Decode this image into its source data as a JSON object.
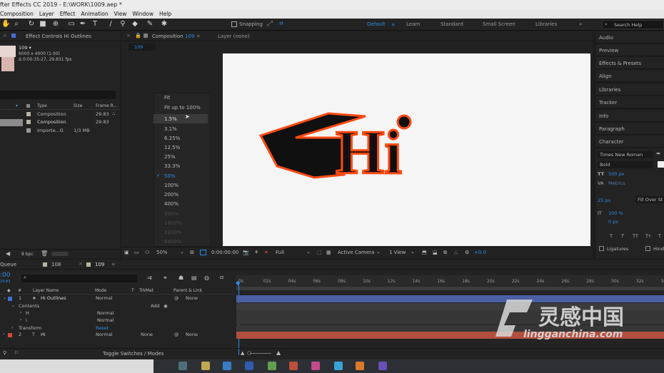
{
  "title": "fter Effects CC 2019 - E:\\WORK\\1009.aep *",
  "menu": [
    "Composition",
    "Layer",
    "Effect",
    "Animation",
    "View",
    "Window",
    "Help"
  ],
  "toolbar": {
    "snapping": "Snapping",
    "workspaces": [
      "Default",
      "Learn",
      "Standard",
      "Small Screen",
      "Libraries"
    ],
    "search": "Search Help"
  },
  "project": {
    "effect_tab": "Effect Controls Hi Outlines",
    "item_name": "109 ▾",
    "item_size": "6000 x 4000 (1.00)",
    "item_dur": "Δ 0:00:35:27, 29.831 fps",
    "columns": [
      "Type",
      "Size",
      "Frame R..."
    ],
    "rows": [
      {
        "type": "Composition",
        "size": "",
        "fps": "29.83"
      },
      {
        "type": "Composition",
        "size": "",
        "fps": "29.83"
      },
      {
        "type": "Importe...G",
        "size": "1/3 MB",
        "fps": ""
      }
    ],
    "bpc": "8 bpc"
  },
  "comp": {
    "tab": "Composition",
    "tab_num": "109",
    "layer_tab": "Layer (none)",
    "crumb": "109",
    "zoom_options": [
      "Fit",
      "Fit up to 100%",
      "1.5%",
      "3.1%",
      "6.25%",
      "12.5%",
      "25%",
      "33.3%",
      "50%",
      "100%",
      "200%",
      "400%",
      "800%",
      "1600%",
      "3200%",
      "6400%"
    ],
    "selected_zoom": "50%",
    "hover_zoom": "1.5%",
    "footer": {
      "zoom": "50%",
      "time": "0:00:00:00",
      "res": "Full",
      "camera": "Active Camera",
      "views": "1 View",
      "offset": "+0.0"
    },
    "art_text": "Hi"
  },
  "right_panels": [
    "Audio",
    "Preview",
    "Effects & Presets",
    "Align",
    "Libraries",
    "Tracker",
    "Info",
    "Paragraph",
    "Character"
  ],
  "character": {
    "font": "Times New Roman",
    "style": "Bold",
    "size": "500 px",
    "tracking_label": "Metrics",
    "leading": "25 px",
    "fill_over": "Fill Over St",
    "vscale": "100 %",
    "baseline": "0 px",
    "ligatures": "Ligatures",
    "hindi": "Hindi",
    "styles": [
      "T",
      "T",
      "TT",
      "Tт",
      "T"
    ]
  },
  "timeline": {
    "queue": "Queue",
    "tabs": [
      "108",
      "109"
    ],
    "columns": [
      "#",
      "Layer Name",
      "Mode",
      "T",
      "TrkMat",
      "Parent & Link"
    ],
    "time": ":00",
    "fps": "29.83",
    "ticks": [
      "0s",
      "02s",
      "04s",
      "06s",
      "08s",
      "10s",
      "12s",
      "14s",
      "16s",
      "18s",
      "20s",
      "22s",
      "24s",
      "26s",
      "28s",
      "30s",
      "32s",
      "34"
    ],
    "layers": [
      {
        "num": "1",
        "name": "Hi Outlines",
        "mode": "Normal",
        "parent": "None",
        "color": "#3f6fd8"
      },
      {
        "label": "Contents",
        "add": "Add"
      },
      {
        "label": "H",
        "mode": "Normal"
      },
      {
        "label": "i",
        "mode": "Normal"
      },
      {
        "label": "Transform",
        "reset": "Reset"
      },
      {
        "num": "2",
        "name": "Hi",
        "mode": "Normal",
        "trkmat": "None",
        "parent": "None",
        "color": "#d14a3a"
      }
    ],
    "toggle": "Toggle Switches / Modes"
  },
  "watermark": {
    "cn": "灵感中国",
    "url": "lingganchina.com"
  },
  "colors": {
    "accent": "#2d8ceb",
    "hi_outline": "#ff4a12",
    "hi_fill": "#101010"
  }
}
